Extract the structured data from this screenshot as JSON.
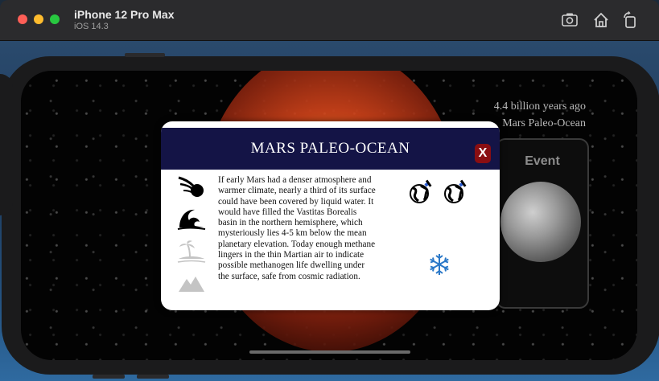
{
  "window": {
    "device": "iPhone 12 Pro Max",
    "os": "iOS 14.3",
    "toolbar_icons": [
      "screenshot-icon",
      "home-icon",
      "rotate-icon"
    ]
  },
  "app": {
    "era_time": "4.4 billion years ago",
    "era_name": "Mars Paleo-Ocean",
    "event_label": "Event"
  },
  "modal": {
    "title": "MARS PALEO-OCEAN",
    "close_label": "X",
    "description": "If early Mars had a denser atmosphere and warmer climate, nearly a third of its surface could have been covered by liquid water. It would have filled the Vastitas Borealis basin in the northern hemisphere, which mysteriously lies 4-5 km below the mean planetary elevation. Today enough methane lingers in the thin Martian air to indicate possible methanogen life dwelling under the surface, safe from cosmic radiation.",
    "category_icons": [
      "meteor-icon",
      "wave-icon",
      "island-icon",
      "mountain-icon"
    ],
    "active_categories": [
      "meteor-icon",
      "wave-icon"
    ],
    "colors": {
      "header": "#141446",
      "close": "#8a0e12"
    }
  }
}
